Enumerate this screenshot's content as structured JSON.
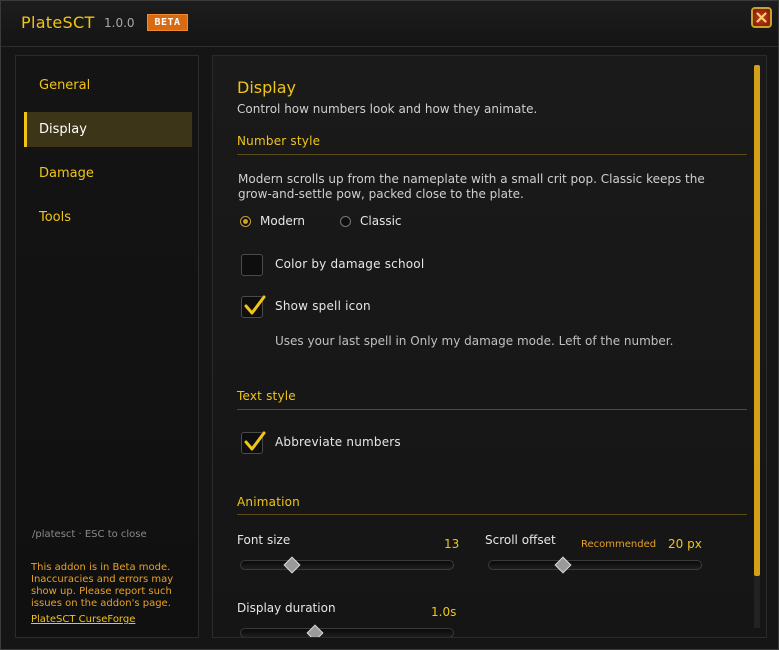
{
  "titlebar": {
    "title": "PlateSCT",
    "version": "1.0.0",
    "badge": "BETA",
    "close_icon": "close-icon"
  },
  "sidebar": {
    "items": [
      {
        "label": "General",
        "active": false
      },
      {
        "label": "Display",
        "active": true
      },
      {
        "label": "Damage",
        "active": false
      },
      {
        "label": "Tools",
        "active": false
      }
    ],
    "hint": "/platesct  ·  ESC to close",
    "beta_note": "This addon is in Beta mode. Inaccuracies and errors may show up. Please report such issues on the addon's page.",
    "link": "PlateSCT CurseForge"
  },
  "main": {
    "title": "Display",
    "subtitle": "Control how numbers look and how they animate.",
    "number_style": {
      "title": "Number style",
      "description": "Modern scrolls up from the nameplate with a small crit pop. Classic keeps the grow-and-settle pow, packed close to the plate.",
      "options": [
        {
          "label": "Modern",
          "selected": true
        },
        {
          "label": "Classic",
          "selected": false
        }
      ],
      "color_by_school": {
        "label": "Color by damage school",
        "checked": false
      },
      "show_spell_icon": {
        "label": "Show spell icon",
        "checked": true
      },
      "spell_icon_note": "Uses your last spell in Only my damage mode. Left of the number."
    },
    "text_style": {
      "title": "Text style",
      "abbreviate": {
        "label": "Abbreviate numbers",
        "checked": true
      }
    },
    "animation": {
      "title": "Animation",
      "font_size": {
        "label": "Font size",
        "value": "13",
        "fraction": 0.24
      },
      "scroll_offset": {
        "label": "Scroll offset",
        "recommended": "Recommended",
        "value": "20 px",
        "fraction": 0.35
      },
      "display_duration": {
        "label": "Display duration",
        "value": "1.0s",
        "fraction": 0.35
      }
    }
  },
  "colors": {
    "accent": "#f0c419",
    "badge": "#d76a12",
    "active_nav": "#3d3517",
    "scrollbar": "#d4a017"
  }
}
